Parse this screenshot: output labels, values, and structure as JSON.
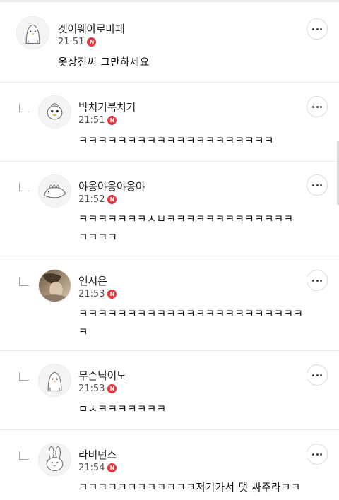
{
  "comments": [
    {
      "nickname": "겟어웨아로마패",
      "time": "21:51",
      "badge": "N",
      "text": "옷상진씨 그만하세요",
      "is_reply": false,
      "avatar_icon": "penguin-icon"
    },
    {
      "nickname": "박치기북치기",
      "time": "21:51",
      "badge": "N",
      "text": "ㅋㅋㅋㅋㅋㅋㅋㅋㅋㅋㅋㅋㅋㅋㅋㅋㅋㅋㅋㅋ",
      "is_reply": true,
      "avatar_icon": "chick-icon"
    },
    {
      "nickname": "야옹야옹야옹야",
      "time": "21:52",
      "badge": "N",
      "text": "ㅋㅋㅋㅋㅋㅋㅋㅅㅂㅋㅋㅋㅋㅋㅋㅋㅋㅋㅋㅋㅋㅋ\nㅋㅋㅋㅋ",
      "is_reply": true,
      "avatar_icon": "dinosaur-icon"
    },
    {
      "nickname": "연시은",
      "time": "21:53",
      "badge": "N",
      "text": "ㅋㅋㅋㅋㅋㅋㅋㅋㅋㅋㅋㅋㅋㅋㅋㅋㅋㅋㅋㅋㅋㅋㅋ\nㅋ",
      "is_reply": true,
      "avatar_icon": "photo-avatar"
    },
    {
      "nickname": "무슨닉이노",
      "time": "21:53",
      "badge": "N",
      "text": "ㅁㅊㅋㅋㅋㅋㅋㅋㅋ",
      "is_reply": true,
      "avatar_icon": "penguin-icon"
    },
    {
      "nickname": "라비던스",
      "time": "21:54",
      "badge": "N",
      "text": "ㅋㅋㅋㅋㅋㅋㅋㅋㅋㅋㅋㅋ저기가서 댓 싸주라ㅋㅋ",
      "is_reply": true,
      "avatar_icon": "rabbit-icon"
    }
  ],
  "colors": {
    "badge": "#e8343e",
    "divider": "#e9e9e9",
    "text": "#222222"
  },
  "icons": {
    "more": "more-horizontal-icon",
    "reply": "reply-arrow-icon"
  }
}
